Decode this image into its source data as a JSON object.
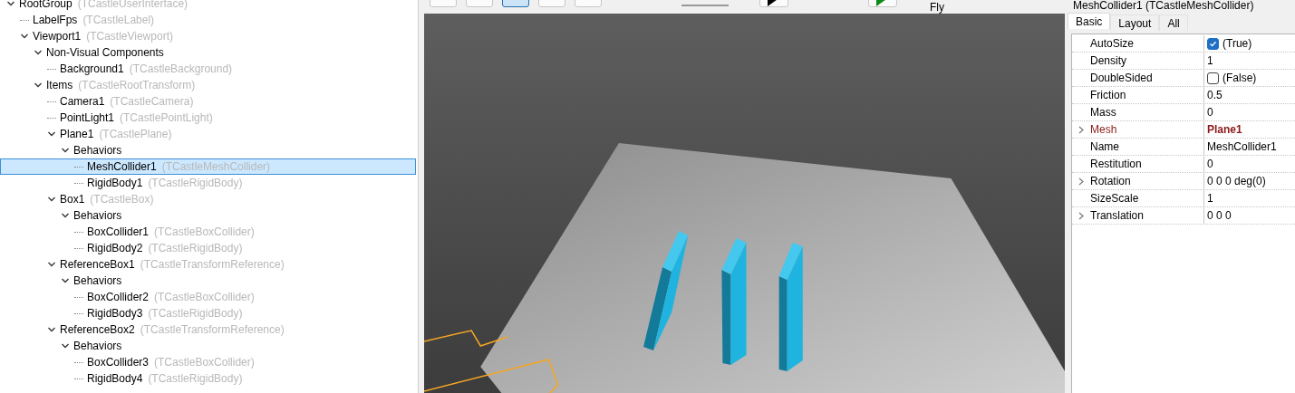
{
  "hierarchy": [
    {
      "name": "RootGroup",
      "type": "(TCastleUserInterface)",
      "selected": false,
      "expanded": true,
      "children": [
        {
          "name": "LabelFps",
          "type": "(TCastleLabel)",
          "selected": false
        },
        {
          "name": "Viewport1",
          "type": "(TCastleViewport)",
          "selected": false,
          "expanded": true,
          "children": [
            {
              "name": "Non-Visual Components",
              "selected": false,
              "expanded": true,
              "children": [
                {
                  "name": "Background1",
                  "type": "(TCastleBackground)",
                  "selected": false
                }
              ]
            },
            {
              "name": "Items",
              "type": "(TCastleRootTransform)",
              "selected": false,
              "expanded": true,
              "children": [
                {
                  "name": "Camera1",
                  "type": "(TCastleCamera)",
                  "selected": false
                },
                {
                  "name": "PointLight1",
                  "type": "(TCastlePointLight)",
                  "selected": false
                },
                {
                  "name": "Plane1",
                  "type": "(TCastlePlane)",
                  "selected": false,
                  "expanded": true,
                  "children": [
                    {
                      "name": "Behaviors",
                      "selected": false,
                      "expanded": true,
                      "children": [
                        {
                          "name": "MeshCollider1",
                          "type": "(TCastleMeshCollider)",
                          "selected": true
                        },
                        {
                          "name": "RigidBody1",
                          "type": "(TCastleRigidBody)",
                          "selected": false
                        }
                      ]
                    }
                  ]
                },
                {
                  "name": "Box1",
                  "type": "(TCastleBox)",
                  "selected": false,
                  "expanded": true,
                  "children": [
                    {
                      "name": "Behaviors",
                      "selected": false,
                      "expanded": true,
                      "children": [
                        {
                          "name": "BoxCollider1",
                          "type": "(TCastleBoxCollider)",
                          "selected": false
                        },
                        {
                          "name": "RigidBody2",
                          "type": "(TCastleRigidBody)",
                          "selected": false
                        }
                      ]
                    }
                  ]
                },
                {
                  "name": "ReferenceBox1",
                  "type": "(TCastleTransformReference)",
                  "selected": false,
                  "expanded": true,
                  "children": [
                    {
                      "name": "Behaviors",
                      "selected": false,
                      "expanded": true,
                      "children": [
                        {
                          "name": "BoxCollider2",
                          "type": "(TCastleBoxCollider)",
                          "selected": false
                        },
                        {
                          "name": "RigidBody3",
                          "type": "(TCastleRigidBody)",
                          "selected": false
                        }
                      ]
                    }
                  ]
                },
                {
                  "name": "ReferenceBox2",
                  "type": "(TCastleTransformReference)",
                  "selected": false,
                  "expanded": true,
                  "children": [
                    {
                      "name": "Behaviors",
                      "selected": false,
                      "expanded": true,
                      "children": [
                        {
                          "name": "BoxCollider3",
                          "type": "(TCastleBoxCollider)",
                          "selected": false
                        },
                        {
                          "name": "RigidBody4",
                          "type": "(TCastleRigidBody)",
                          "selected": false
                        }
                      ]
                    }
                  ]
                }
              ]
            }
          ]
        }
      ]
    }
  ],
  "toolbar": {
    "tools": [
      {
        "selected": false
      },
      {
        "selected": false
      },
      {
        "selected": true
      },
      {
        "selected": false
      },
      {
        "selected": false
      }
    ],
    "navigation_label": "Fly"
  },
  "inspector": {
    "title": "MeshCollider1 (TCastleMeshCollider)",
    "tabs": [
      {
        "label": "Basic",
        "selected": true
      },
      {
        "label": "Layout",
        "selected": false
      },
      {
        "label": "All",
        "selected": false
      }
    ],
    "properties": [
      {
        "name": "AutoSize",
        "kind": "checkbox",
        "checked": true,
        "value": "(True)",
        "expandable": false,
        "modified": false
      },
      {
        "name": "Density",
        "kind": "text",
        "value": "1",
        "expandable": false,
        "modified": false
      },
      {
        "name": "DoubleSided",
        "kind": "checkbox",
        "checked": false,
        "value": "(False)",
        "expandable": false,
        "modified": false
      },
      {
        "name": "Friction",
        "kind": "text",
        "value": "0.5",
        "expandable": false,
        "modified": false
      },
      {
        "name": "Mass",
        "kind": "text",
        "value": "0",
        "expandable": false,
        "modified": false
      },
      {
        "name": "Mesh",
        "kind": "text",
        "value": "Plane1",
        "expandable": true,
        "modified": true
      },
      {
        "name": "Name",
        "kind": "text",
        "value": "MeshCollider1",
        "expandable": false,
        "modified": false
      },
      {
        "name": "Restitution",
        "kind": "text",
        "value": "0",
        "expandable": false,
        "modified": false
      },
      {
        "name": "Rotation",
        "kind": "text",
        "value": "0 0 0 deg(0)",
        "expandable": true,
        "modified": false
      },
      {
        "name": "SizeScale",
        "kind": "text",
        "value": "1",
        "expandable": false,
        "modified": false
      },
      {
        "name": "Translation",
        "kind": "text",
        "value": "0 0 0",
        "expandable": true,
        "modified": false
      }
    ]
  }
}
